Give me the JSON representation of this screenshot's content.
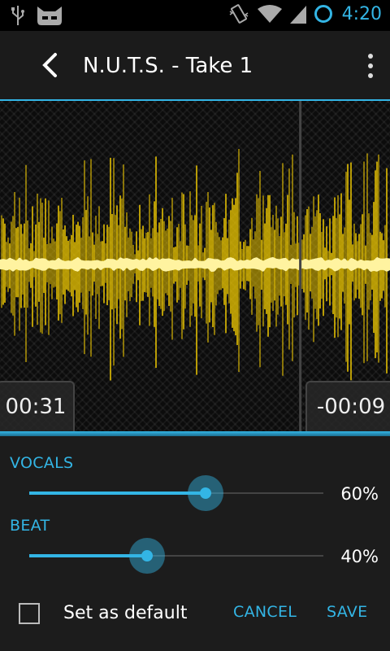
{
  "status_bar": {
    "time": "4:20",
    "icons": [
      "usb-icon",
      "cyanogen-mascot-icon",
      "vibrate-icon",
      "wifi-icon",
      "signal-icon",
      "sync-ring-icon"
    ]
  },
  "action_bar": {
    "title": "N.U.T.S. - Take 1",
    "back_icon": "chevron-left-icon",
    "overflow_icon": "overflow-menu-icon"
  },
  "waveform": {
    "elapsed": "00:31",
    "remaining": "-00:09",
    "progress": 0.77,
    "color": "#ffd600",
    "core_color": "#fff3a0"
  },
  "mixer": {
    "vocals": {
      "label": "VOCALS",
      "value": 60,
      "display": "60%"
    },
    "beat": {
      "label": "BEAT",
      "value": 40,
      "display": "40%"
    }
  },
  "footer": {
    "set_default_label": "Set as default",
    "set_default_checked": false,
    "cancel_label": "CANCEL",
    "save_label": "SAVE"
  },
  "colors": {
    "accent": "#33b5e5",
    "waveform": "#ffd600"
  }
}
